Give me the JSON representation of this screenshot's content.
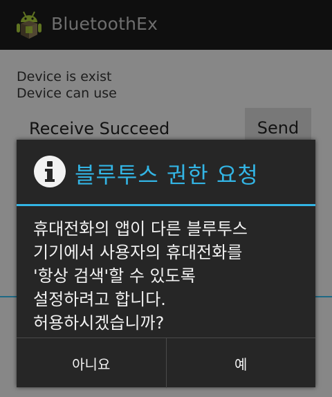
{
  "app": {
    "title": "BluetoothEx"
  },
  "main": {
    "status_lines": [
      "Device is exist",
      "Device can use"
    ],
    "receive_text": "Receive Succeed",
    "send_label": "Send"
  },
  "dialog": {
    "title": "블루투스 권한 요청",
    "message_lines": [
      "휴대전화의 앱이 다른 블루투스",
      "기기에서 사용자의 휴대전화를",
      "'항상 검색'할 수 있도록",
      "설정하려고 합니다.",
      "허용하시겠습니까?"
    ],
    "buttons": {
      "negative": "아니요",
      "positive": "예"
    }
  },
  "colors": {
    "accent": "#33b5e5",
    "actionbar": "#1a1a1a",
    "dialog_bg": "#262626"
  },
  "icons": {
    "app": "android-robot-icon",
    "dialog": "info-icon"
  }
}
